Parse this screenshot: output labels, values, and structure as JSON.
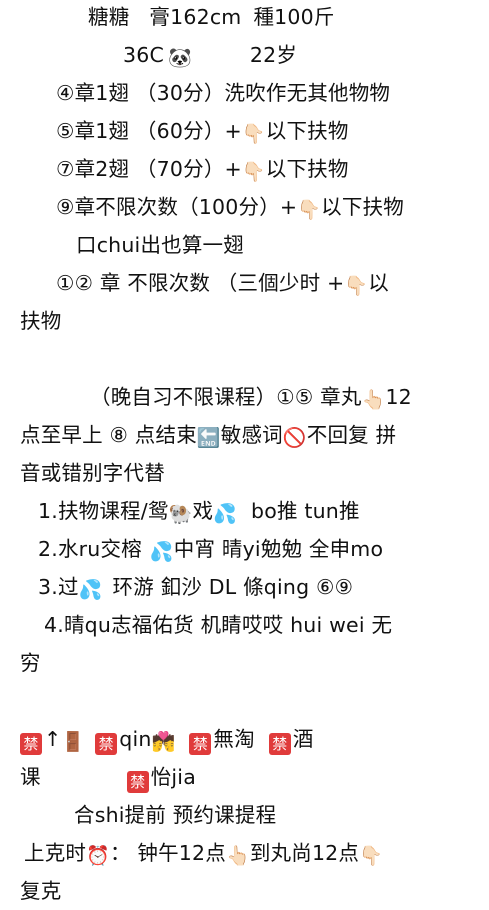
{
  "note": {
    "l1": {
      "name": "糖糖",
      "height": "膏162cm",
      "weight": "種100斤"
    },
    "l2": {
      "cup": "36C",
      "panda_icon": "🐼",
      "age": "22岁"
    },
    "l3": "④章1翅 （30分）洗吹作无其他物物",
    "l4": {
      "a": "⑤章1翅 （60分）+",
      "pointer_icon": "👇🏻",
      "b": "以下扶物"
    },
    "l5": {
      "a": "⑦章2翅 （70分）+",
      "pointer_icon": "👇🏻",
      "b": "以下扶物"
    },
    "l6": {
      "a": "⑨章不限次数（100分）+",
      "pointer_icon": "👇🏻",
      "b": "以下扶物"
    },
    "l7": "口chui出也算一翅",
    "l8": {
      "a": "①② 章 不限次数 （三個少时 +",
      "pointer_icon": "👇🏻",
      "b": "以"
    },
    "l9": "扶物",
    "l10": {
      "a": "（晚自习不限课程）①⑤ 章丸",
      "pointer_icon": "👆🏻",
      "b": "12"
    },
    "l11": {
      "a": "点至早上 ⑧ 点结束",
      "end_icon": "🔚",
      "b": "敏感词",
      "no_icon": "🚫",
      "c": "不回复 拼"
    },
    "l12": "音或错别字代替",
    "l13": {
      "a": "1.扶物课程/鸳",
      "sheep_icon": "🐏",
      "b": "戏",
      "water_icon": "💦",
      "c": "bo推 tun推"
    },
    "l14": {
      "a": "2.水ru交榕",
      "water_icon": "💦",
      "b": "中宵 晴yi勉勉 全申mo"
    },
    "l15": {
      "a": "3.过",
      "water_icon": "💦",
      "b": "环游 釦沙 DL 條qing ⑥⑨"
    },
    "l16": "4.晴qu志福佑货 机睛哎哎 hui wei 无",
    "l17": "穷",
    "l18": {
      "ban_glyph": "禁",
      "arrow": "↑",
      "door_icon": "🚪",
      "b": "qin",
      "kiss_icon": "💏",
      "c": "無淘",
      "d": "酒"
    },
    "l19": {
      "a": "课",
      "ban_glyph": "禁",
      "b": "怡jia"
    },
    "l20": "合shi提前 预约课提程",
    "l21": {
      "a": "上克时",
      "clock_icon": "⏰",
      "b": "： 钟午12点",
      "pointer_up_icon": "👆🏻",
      "c": "到丸尚12点",
      "pointer_icon": "👇🏻"
    },
    "l22": "复克"
  }
}
